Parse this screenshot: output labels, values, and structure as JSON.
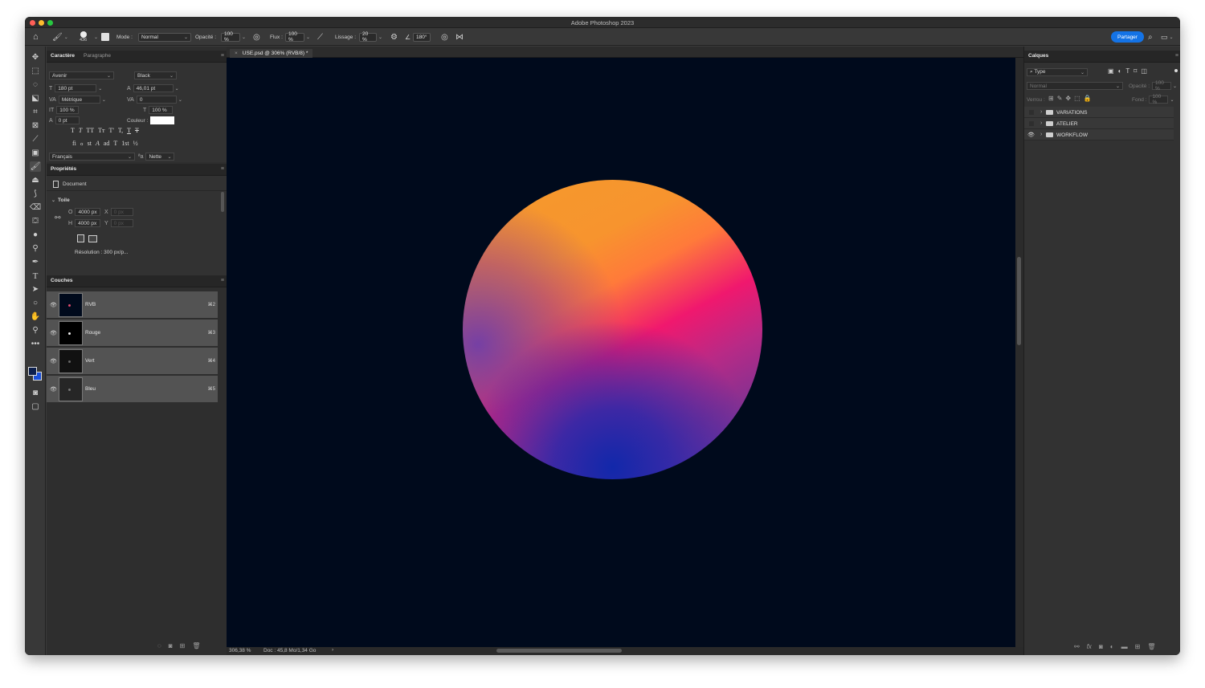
{
  "window": {
    "title": "Adobe Photoshop 2023"
  },
  "options_bar": {
    "brush_size": "436",
    "mode_label": "Mode :",
    "mode_value": "Normal",
    "opacity_label": "Opacité :",
    "opacity_value": "100 %",
    "flow_label": "Flux :",
    "flow_value": "100 %",
    "smoothing_label": "Lissage :",
    "smoothing_value": "20 %",
    "angle_value": "180°",
    "share_label": "Partager"
  },
  "character_panel": {
    "tabs": [
      "Caractère",
      "Paragraphe"
    ],
    "font_family": "Avenir",
    "font_style": "Black",
    "font_size": "180 pt",
    "leading": "46,01 pt",
    "kerning": "Métrique",
    "tracking": "0",
    "vertical_scale": "100 %",
    "horizontal_scale": "100 %",
    "baseline_shift": "0 pt",
    "color_label": "Couleur :",
    "color_value": "#ffffff",
    "style_buttons_row1": [
      "T",
      "T",
      "TT",
      "Tт",
      "T'",
      "T,",
      "T",
      "T"
    ],
    "style_buttons_row2": [
      "fi",
      "ℴ",
      "st",
      "A",
      "ad",
      "T",
      "1st",
      "½"
    ],
    "language": "Français",
    "antialias_label": "ªa",
    "antialias": "Nette"
  },
  "properties_panel": {
    "title": "Propriétés",
    "document_label": "Document",
    "section_label": "Toile",
    "width_label": "O",
    "width_value": "4000 px",
    "height_label": "H",
    "height_value": "4000 px",
    "x_label": "X",
    "x_placeholder": "0 px",
    "y_label": "Y",
    "y_placeholder": "0 px",
    "resolution": "Résolution : 300 px/p..."
  },
  "channels_panel": {
    "title": "Couches",
    "channels": [
      {
        "name": "RVB",
        "shortcut": "⌘2"
      },
      {
        "name": "Rouge",
        "shortcut": "⌘3"
      },
      {
        "name": "Vert",
        "shortcut": "⌘4"
      },
      {
        "name": "Bleu",
        "shortcut": "⌘5"
      }
    ]
  },
  "document": {
    "tab_label": "USE.psd @ 306% (RVB/8) *",
    "zoom": "306,38 %",
    "doc_info": "Doc : 45,8 Mo/1,34 Go",
    "status_arrow": "›"
  },
  "layers_panel": {
    "title": "Calques",
    "filter_value": "Type",
    "blend_mode": "Normal",
    "opacity_label": "Opacité :",
    "opacity_value": "100 %",
    "lock_label": "Verrou :",
    "fill_label": "Fond :",
    "fill_value": "100 %",
    "layers": [
      {
        "name": "VARIATIONS",
        "visible": false
      },
      {
        "name": "ATELIER",
        "visible": false
      },
      {
        "name": "WORKFLOW",
        "visible": true
      }
    ]
  },
  "colors": {
    "canvas_bg": "#000a1c",
    "accent": "#1473e6",
    "foreground_swatch": "#0c1f4d",
    "background_swatch": "#1a4fd8"
  },
  "icons": {
    "home": "home-icon",
    "brush": "brush-icon",
    "search": "search-icon",
    "layout": "workspace-icon"
  }
}
